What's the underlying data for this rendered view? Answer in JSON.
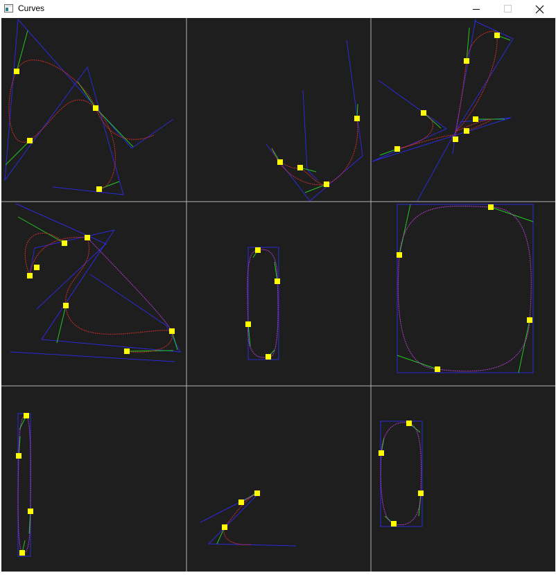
{
  "window": {
    "title": "Curves",
    "controls": [
      "minimize",
      "maximize",
      "close"
    ]
  },
  "colors": {
    "background": "#1e1e1e",
    "grid_lines": "#b4b4b4",
    "control_polygon": "#2b2bd9",
    "tangent": "#22c922",
    "bezier_curve": "#e03030",
    "spline_curve": "#c040e0",
    "control_point": "#ffff00"
  },
  "grid": {
    "rows": 3,
    "columns": 3
  }
}
